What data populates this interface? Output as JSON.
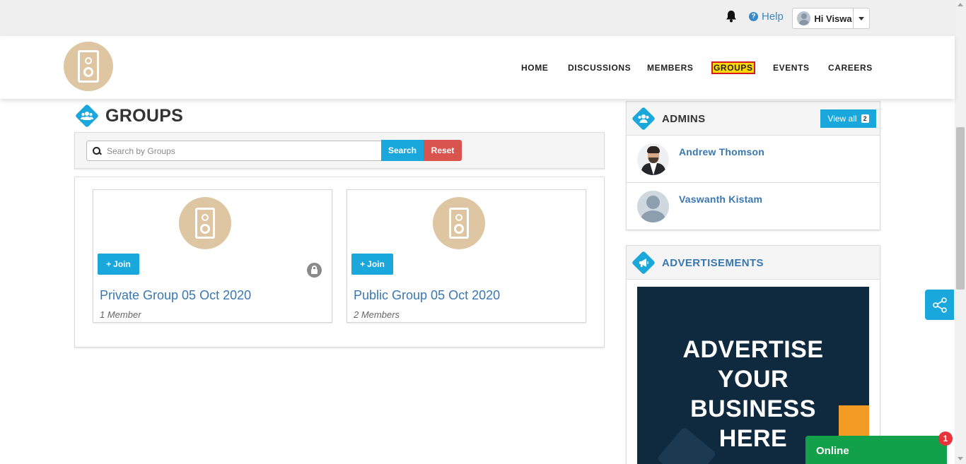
{
  "topbar": {
    "help_label": "Help",
    "user_greeting": "Hi Viswa"
  },
  "nav": {
    "items": [
      {
        "label": "HOME"
      },
      {
        "label": "DISCUSSIONS"
      },
      {
        "label": "MEMBERS"
      },
      {
        "label": "GROUPS",
        "active": true
      },
      {
        "label": "EVENTS"
      },
      {
        "label": "CAREERS"
      }
    ]
  },
  "page": {
    "title": "GROUPS",
    "search": {
      "placeholder": "Search by Groups",
      "value": "",
      "search_label": "Search",
      "reset_label": "Reset"
    }
  },
  "groups": [
    {
      "join_label": "Join",
      "name": "Private Group 05 Oct 2020",
      "members": "1 Member",
      "private": true
    },
    {
      "join_label": "Join",
      "name": "Public Group 05 Oct 2020",
      "members": "2 Members",
      "private": false
    }
  ],
  "admins": {
    "title": "ADMINS",
    "view_all_label": "View all",
    "count": "2",
    "list": [
      {
        "name": "Andrew Thomson"
      },
      {
        "name": "Vaswanth Kistam"
      }
    ]
  },
  "ads": {
    "title": "ADVERTISEMENTS",
    "banner_lines": [
      "ADVERTISE",
      "YOUR",
      "BUSINESS",
      "HERE"
    ]
  },
  "chat": {
    "status": "Online",
    "badge": "1"
  },
  "colors": {
    "accent": "#1aa7db",
    "danger": "#d9534f",
    "link": "#3a77b0",
    "online": "#13a04a",
    "logo_bg": "#dfc6a3"
  },
  "icons": [
    "bell-icon",
    "help-icon",
    "user-avatar-icon",
    "speaker-logo-icon",
    "groups-icon",
    "search-icon",
    "plus-icon",
    "lock-icon",
    "bullhorn-icon",
    "share-icon"
  ]
}
